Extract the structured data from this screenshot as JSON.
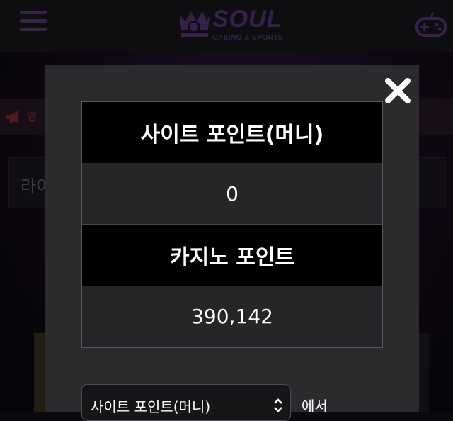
{
  "header": {
    "logo_text": "SOUL",
    "logo_sub": "CASINO & SPORTS"
  },
  "notice": {
    "text": "영"
  },
  "section": {
    "title": "라이"
  },
  "modal": {
    "site_point_label": "사이트 포인트(머니)",
    "site_point_value": "0",
    "casino_point_label": "카지노 포인트",
    "casino_point_value": "390,142",
    "select_value": "사이트 포인트(머니)",
    "from_label": "에서"
  },
  "colors": {
    "brand_purple": "#5d3a83",
    "modal_bg": "#2b2a2d",
    "notice_red": "#8b2f34"
  },
  "icons": [
    "menu-icon",
    "crown-logo-icon",
    "gamepad-icon",
    "megaphone-icon",
    "close-icon",
    "chevron-updown-icon"
  ]
}
